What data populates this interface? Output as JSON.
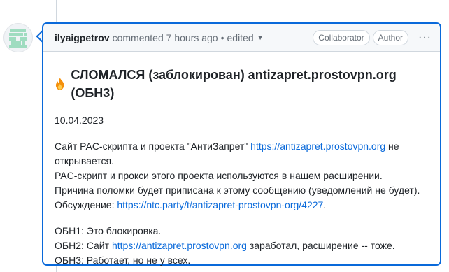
{
  "comment": {
    "author": "ilyaigpetrov",
    "action": "commented",
    "time": "7 hours ago",
    "separator": "•",
    "edited": "edited",
    "badges": [
      "Collaborator",
      "Author"
    ],
    "more_icon": "kebab-horizontal-icon"
  },
  "body": {
    "title_icon": "fire-icon",
    "title": "СЛОМАЛСЯ (заблокирован) antizapret.prostovpn.org (ОБН3)",
    "date": "10.04.2023",
    "p2": {
      "l1_pre": "Сайт PAC-скрипта и проекта \"АнтиЗапрет\" ",
      "l1_link": "https://antizapret.prostovpn.org",
      "l1_post": " не открывается.",
      "l2": "PAC-скрипт и прокси этого проекта используются в нашем расширении.",
      "l3": "Причина поломки будет приписана к этому сообщению (уведомлений не будет).",
      "l4_pre": "Обсуждение: ",
      "l4_link": "https://ntc.party/t/antizapret-prostovpn-org/4227",
      "l4_post": "."
    },
    "p3": {
      "l1": "ОБН1: Это блокировка.",
      "l2_pre": "ОБН2: Сайт ",
      "l2_link": "https://antizapret.prostovpn.org",
      "l2_post": " заработал, расширение -- тоже.",
      "l3": "ОБН3: Работает, но не у всех."
    }
  },
  "colors": {
    "link": "#0969da",
    "focus_border": "#0969da",
    "avatar": "#9fdcc0"
  }
}
